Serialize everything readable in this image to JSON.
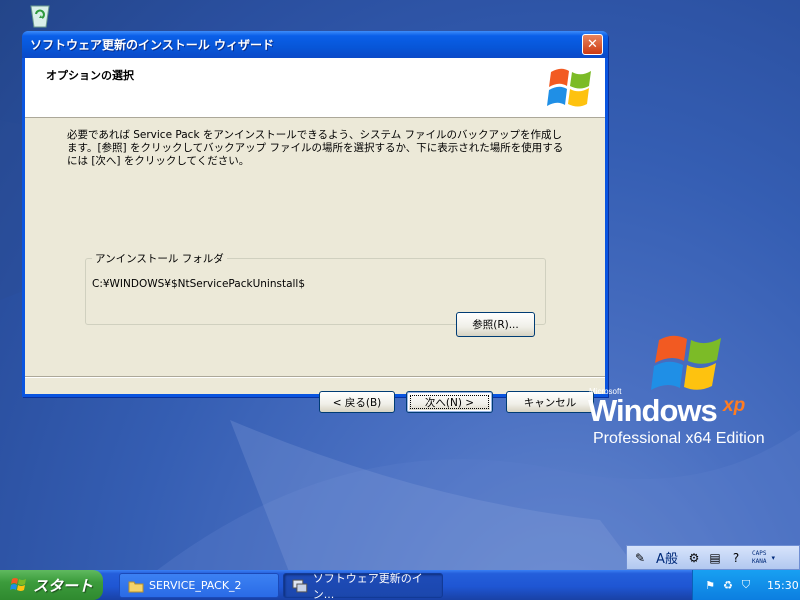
{
  "dialog": {
    "title": "ソフトウェア更新のインストール ウィザード",
    "header_title": "オプションの選択",
    "description": "必要であれば Service Pack をアンインストールできるよう、システム ファイルのバックアップを作成します。[参照] をクリックしてバックアップ ファイルの場所を選択するか、下に表示された場所を使用するには [次へ] をクリックしてください。",
    "group_label": "アンインストール フォルダ",
    "folder_path": "C:¥WINDOWS¥$NtServicePackUninstall$",
    "browse_label": "参照(R)...",
    "back_label": "< 戻る(B)",
    "next_label": "次へ(N) >",
    "cancel_label": "キャンセル",
    "close_glyph": "✕"
  },
  "brand": {
    "microsoft": "Microsoft",
    "windows": "Windows",
    "xp": "xp",
    "edition": "Professional x64 Edition"
  },
  "langbar": {
    "ime_mode": "A般",
    "caps": "CAPS",
    "kana": "KANA"
  },
  "taskbar": {
    "start_label": "スタート",
    "tasks": [
      {
        "label": "SERVICE_PACK_2",
        "icon": "folder-icon"
      },
      {
        "label": "ソフトウェア更新のイン...",
        "icon": "setup-icon"
      }
    ],
    "clock": "15:30"
  },
  "colors": {
    "desktop": "#355eb3",
    "title_blue": "#0a55e0",
    "dialog_face": "#ece9d8",
    "start_green": "#3c9c3c",
    "tray_blue": "#0c7ee0"
  }
}
